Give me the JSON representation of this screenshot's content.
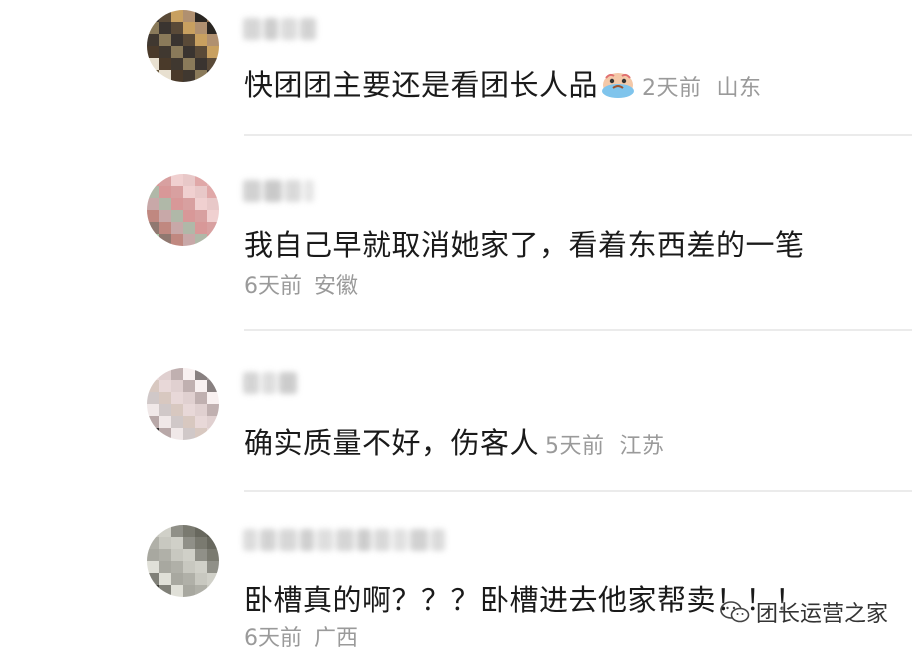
{
  "comments": [
    {
      "text": "快团团主要还是看团长人品",
      "time": "2天前",
      "location": "山东",
      "emoji": "crying-face-emoji",
      "avatar_colors": [
        "#3a3430",
        "#6a5a40",
        "#c8a060",
        "#4a3a2a",
        "#2a2622",
        "#8a7a5a",
        "#d8c8a0",
        "#5a4a38",
        "#e8e0d0",
        "#b09070",
        "#403830",
        "#907050"
      ]
    },
    {
      "text": "我自己早就取消她家了，看着东西差的一笔",
      "time": "6天前",
      "location": "安徽",
      "avatar_colors": [
        "#e8b8b8",
        "#d89898",
        "#a8c0a0",
        "#f0d0d0",
        "#c08880",
        "#e0a8a8",
        "#b0b8a8",
        "#f4e0e0",
        "#d8a0a0",
        "#907870",
        "#e8c8c8",
        "#c8a8a8"
      ]
    },
    {
      "text": "确实质量不好，伤客人",
      "time": "5天前",
      "location": "江苏",
      "avatar_colors": [
        "#d0c8c8",
        "#a09898",
        "#e8d8d8",
        "#2a2828",
        "#c0b0b0",
        "#f0e8e8",
        "#888080",
        "#d8c8c0",
        "#4a4040",
        "#e0d0d0",
        "#b8a8a8",
        "#f8f0f0"
      ]
    },
    {
      "text": "卧槽真的啊？？？卧槽进去他家帮卖！！！",
      "time": "6天前",
      "location": "广西",
      "avatar_colors": [
        "#7a7a70",
        "#a8a8a0",
        "#5a5a50",
        "#c8c8c0",
        "#3a3a34",
        "#909088",
        "#e0e0d8",
        "#68685e",
        "#b0b0a8",
        "#484840",
        "#d0d0c8",
        "#808078"
      ]
    }
  ],
  "watermark": {
    "text": "团长运营之家",
    "icon": "wechat-icon"
  },
  "colors": {
    "text": "#1a1a1a",
    "meta": "#9a9a9a",
    "divider": "#ebebeb"
  }
}
